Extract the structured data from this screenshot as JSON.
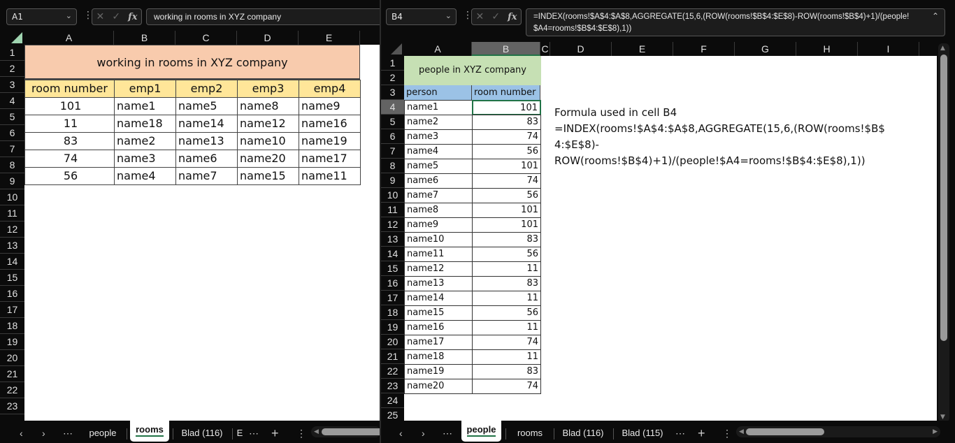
{
  "left": {
    "name_box": "A1",
    "formula": "working in rooms in XYZ company",
    "columns": [
      "A",
      "B",
      "C",
      "D",
      "E"
    ],
    "rows": [
      "1",
      "2",
      "3",
      "4",
      "5",
      "6",
      "7",
      "8",
      "9",
      "10",
      "11",
      "12",
      "13",
      "14",
      "15",
      "16",
      "17",
      "18",
      "19",
      "20",
      "21",
      "22",
      "23"
    ],
    "title": "working in rooms in XYZ company",
    "headers": [
      "room number",
      "emp1",
      "emp2",
      "emp3",
      "emp4"
    ],
    "data": [
      [
        "101",
        "name1",
        "name5",
        "name8",
        "name9"
      ],
      [
        "11",
        "name18",
        "name14",
        "name12",
        "name16"
      ],
      [
        "83",
        "name2",
        "name13",
        "name10",
        "name19"
      ],
      [
        "74",
        "name3",
        "name6",
        "name20",
        "name17"
      ],
      [
        "56",
        "name4",
        "name7",
        "name15",
        "name11"
      ]
    ],
    "tabs": [
      "people",
      "rooms",
      "Blad (116)",
      "E"
    ],
    "active_tab": "rooms",
    "colors": {
      "title_fill": "#f8cbad",
      "header_fill": "#ffe699"
    }
  },
  "right": {
    "name_box": "B4",
    "formula_line1": "=INDEX(rooms!$A$4:$A$8,AGGREGATE(15,6,(ROW(rooms!$B$4:$E$8)-ROW(rooms!$B$4)+1)/(people!",
    "formula_line2": "$A4=rooms!$B$4:$E$8),1))",
    "columns": [
      "A",
      "B",
      "C",
      "D",
      "E",
      "F",
      "G",
      "H",
      "I"
    ],
    "rows": [
      "1",
      "2",
      "3",
      "4",
      "5",
      "6",
      "7",
      "8",
      "9",
      "10",
      "11",
      "12",
      "13",
      "14",
      "15",
      "16",
      "17",
      "18",
      "19",
      "20",
      "21",
      "22",
      "23",
      "24",
      "25"
    ],
    "title": "people in XYZ company",
    "headers": [
      "person",
      "room number"
    ],
    "data": [
      [
        "name1",
        "101"
      ],
      [
        "name2",
        "83"
      ],
      [
        "name3",
        "74"
      ],
      [
        "name4",
        "56"
      ],
      [
        "name5",
        "101"
      ],
      [
        "name6",
        "74"
      ],
      [
        "name7",
        "56"
      ],
      [
        "name8",
        "101"
      ],
      [
        "name9",
        "101"
      ],
      [
        "name10",
        "83"
      ],
      [
        "name11",
        "56"
      ],
      [
        "name12",
        "11"
      ],
      [
        "name13",
        "83"
      ],
      [
        "name14",
        "11"
      ],
      [
        "name15",
        "56"
      ],
      [
        "name16",
        "11"
      ],
      [
        "name17",
        "74"
      ],
      [
        "name18",
        "11"
      ],
      [
        "name19",
        "83"
      ],
      [
        "name20",
        "74"
      ]
    ],
    "note": [
      "Formula used in cell B4",
      "=INDEX(rooms!$A$4:$A$8,AGGREGATE(15,6,(ROW(rooms!$B$",
      "4:$E$8)-",
      "ROW(rooms!$B$4)+1)/(people!$A4=rooms!$B$4:$E$8),1))"
    ],
    "tabs": [
      "people",
      "rooms",
      "Blad (116)",
      "Blad (115)"
    ],
    "active_tab": "people",
    "colors": {
      "title_fill": "#c6e0b4",
      "header_fill": "#9bc2e6",
      "selection": "#217346"
    }
  },
  "icons": {
    "cancel": "✕",
    "enter": "✓",
    "fx": "fx",
    "more": "⋯",
    "add": "+",
    "prev": "‹",
    "next": "›",
    "chevron": "⌄",
    "expand": "⌃"
  }
}
